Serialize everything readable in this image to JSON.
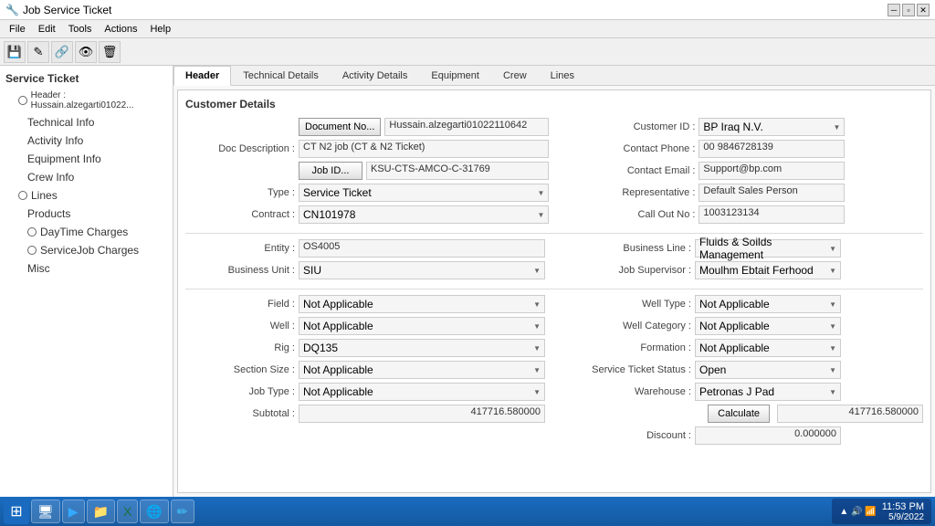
{
  "window": {
    "title": "Job Service Ticket"
  },
  "menu": {
    "items": [
      "File",
      "Edit",
      "Tools",
      "Actions",
      "Help"
    ]
  },
  "toolbar": {
    "icons": [
      "💾",
      "✎",
      "🔗",
      "👁",
      "🗑"
    ]
  },
  "sidebar": {
    "sections": [
      {
        "label": "Service Ticket",
        "type": "parent",
        "children": [
          {
            "label": "Header : Hussain.alzegarti01022...",
            "type": "child",
            "hasCircle": true
          },
          {
            "label": "Technical Info",
            "type": "grandchild"
          },
          {
            "label": "Activity Info",
            "type": "grandchild"
          },
          {
            "label": "Equipment Info",
            "type": "grandchild"
          },
          {
            "label": "Crew Info",
            "type": "grandchild"
          },
          {
            "label": "Lines",
            "type": "child",
            "hasCircle": true
          },
          {
            "label": "Products",
            "type": "grandchild"
          },
          {
            "label": "DayTime Charges",
            "type": "grandchild",
            "hasCircle": true
          },
          {
            "label": "ServiceJob Charges",
            "type": "grandchild",
            "hasCircle": true
          },
          {
            "label": "Misc",
            "type": "grandchild"
          }
        ]
      }
    ]
  },
  "tabs": [
    "Header",
    "Technical Details",
    "Activity Details",
    "Equipment",
    "Crew",
    "Lines"
  ],
  "activeTab": "Header",
  "customerDetails": {
    "sectionTitle": "Customer Details",
    "left": {
      "documentNo": {
        "btnLabel": "Document No...",
        "value": "Hussain.alzegarti01022110642"
      },
      "docDescription": {
        "label": "Doc Description :",
        "value": "CT N2 job (CT & N2 Ticket)"
      },
      "jobId": {
        "btnLabel": "Job ID...",
        "value": "KSU-CTS-AMCO-C-31769"
      },
      "type": {
        "label": "Type :",
        "value": "Service Ticket"
      },
      "contract": {
        "label": "Contract :",
        "value": "CN101978"
      }
    },
    "right": {
      "customerId": {
        "label": "Customer ID :",
        "value": "BP Iraq N.V."
      },
      "contactPhone": {
        "label": "Contact Phone :",
        "value": "00 9846728139"
      },
      "contactEmail": {
        "label": "Contact Email :",
        "value": "Support@bp.com"
      },
      "representative": {
        "label": "Representative :",
        "value": "Default Sales Person"
      },
      "callOutNo": {
        "label": "Call Out No :",
        "value": "1003123134"
      }
    }
  },
  "section2": {
    "left": {
      "entity": {
        "label": "Entity :",
        "value": "OS4005"
      },
      "businessUnit": {
        "label": "Business Unit :",
        "value": "SIU"
      }
    },
    "right": {
      "businessLine": {
        "label": "Business Line :",
        "value": "Fluids & Soilds Management"
      },
      "jobSupervisor": {
        "label": "Job Supervisor :",
        "value": "Moulhm Ebtait Ferhood"
      }
    }
  },
  "section3": {
    "left": {
      "field": {
        "label": "Field :",
        "value": "Not Applicable"
      },
      "well": {
        "label": "Well :",
        "value": "Not Applicable"
      },
      "rig": {
        "label": "Rig :",
        "value": "DQ135"
      },
      "sectionSize": {
        "label": "Section Size :",
        "value": "Not Applicable"
      },
      "jobType": {
        "label": "Job Type :",
        "value": "Not Applicable"
      },
      "subtotal": {
        "label": "Subtotal :",
        "value": "417716.580000"
      }
    },
    "right": {
      "wellType": {
        "label": "Well Type :",
        "value": "Not Applicable"
      },
      "wellCategory": {
        "label": "Well Category :",
        "value": "Not Applicable"
      },
      "formation": {
        "label": "Formation :",
        "value": "Not Applicable"
      },
      "serviceTicketStatus": {
        "label": "Service Ticket Status :",
        "value": "Open"
      },
      "warehouse": {
        "label": "Warehouse :",
        "value": "Petronas J Pad"
      },
      "calculateBtn": "Calculate",
      "subtotalRight": "417716.580000",
      "discount": {
        "label": "Discount :",
        "value": "0.000000"
      }
    }
  },
  "taskbar": {
    "apps": [
      {
        "icon": "⊞",
        "label": "Start",
        "type": "start"
      },
      {
        "icon": "🖥",
        "label": "Desktop"
      },
      {
        "icon": "💻",
        "label": "Terminal"
      },
      {
        "icon": "📁",
        "label": "Files"
      },
      {
        "icon": "📊",
        "label": "Excel"
      },
      {
        "icon": "🌐",
        "label": "Chrome"
      },
      {
        "icon": "✏",
        "label": "Editor"
      }
    ],
    "systemTray": {
      "time": "11:53 PM",
      "date": "5/9/2022"
    }
  }
}
